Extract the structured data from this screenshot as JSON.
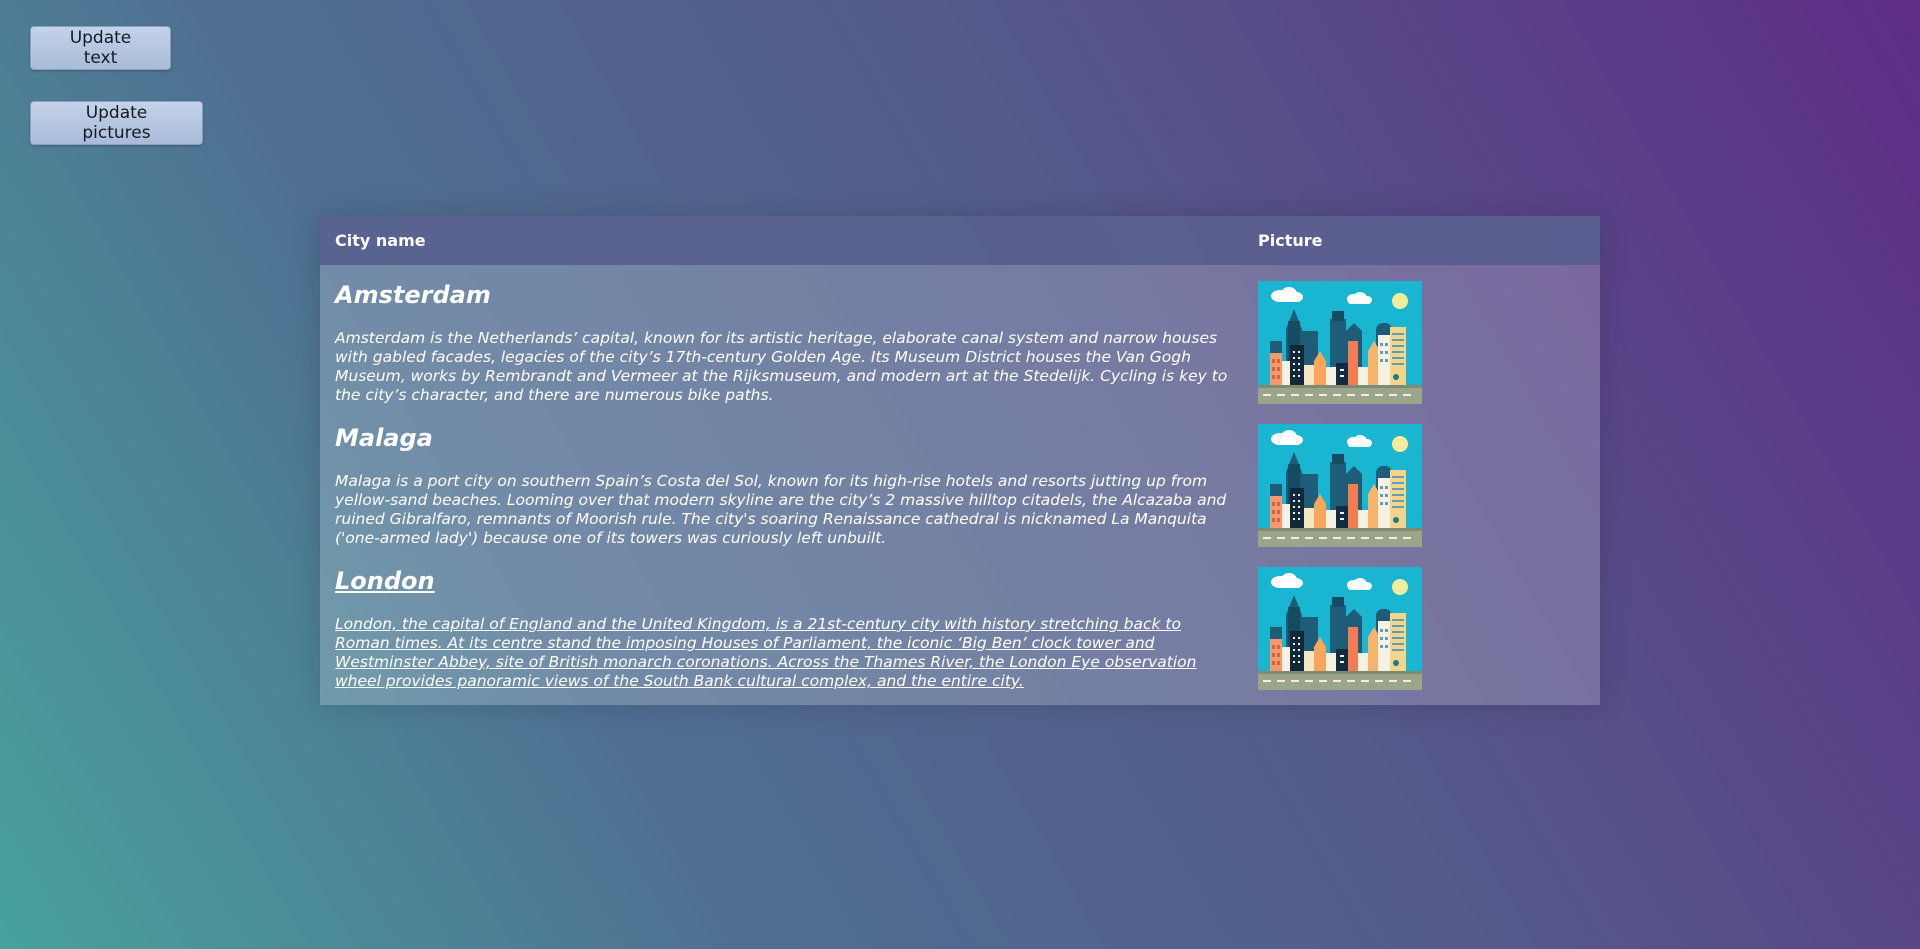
{
  "buttons": {
    "update_text": "Update text",
    "update_pictures": "Update pictures"
  },
  "table": {
    "headers": {
      "city_name": "City name",
      "picture": "Picture"
    },
    "rows": [
      {
        "name": "Amsterdam",
        "description": "Amsterdam is the Netherlands’ capital, known for its artistic heritage, elaborate canal system and narrow houses with gabled facades, legacies of the city’s 17th-century Golden Age. Its Museum District houses the Van Gogh Museum, works by Rembrandt and Vermeer at the Rijksmuseum, and modern art at the Stedelijk. Cycling is key to the city’s character, and there are numerous bike paths.",
        "picture_icon": "city-skyline-illustration"
      },
      {
        "name": "Malaga",
        "description": "Malaga is a port city on southern Spain’s Costa del Sol, known for its high-rise hotels and resorts jutting up from yellow-sand beaches. Looming over that modern skyline are the city’s 2 massive hilltop citadels, the Alcazaba and ruined Gibralfaro, remnants of Moorish rule. The city's soaring Renaissance cathedral is nicknamed La Manquita ('one-armed lady') because one of its towers was curiously left unbuilt.",
        "picture_icon": "city-skyline-illustration"
      },
      {
        "name": "London",
        "description": "London, the capital of England and the United Kingdom, is a 21st-century city with history stretching back to Roman times. At its centre stand the imposing Houses of Parliament, the iconic ‘Big Ben’ clock tower and Westminster Abbey, site of British monarch coronations. Across the Thames River, the London Eye observation wheel provides panoramic views of the South Bank cultural complex, and the entire city.",
        "picture_icon": "city-skyline-illustration"
      }
    ]
  },
  "colors": {
    "picture_sky": "#1ab5d1",
    "picture_road": "#9aa58c",
    "header_bg": "#555c8c"
  }
}
